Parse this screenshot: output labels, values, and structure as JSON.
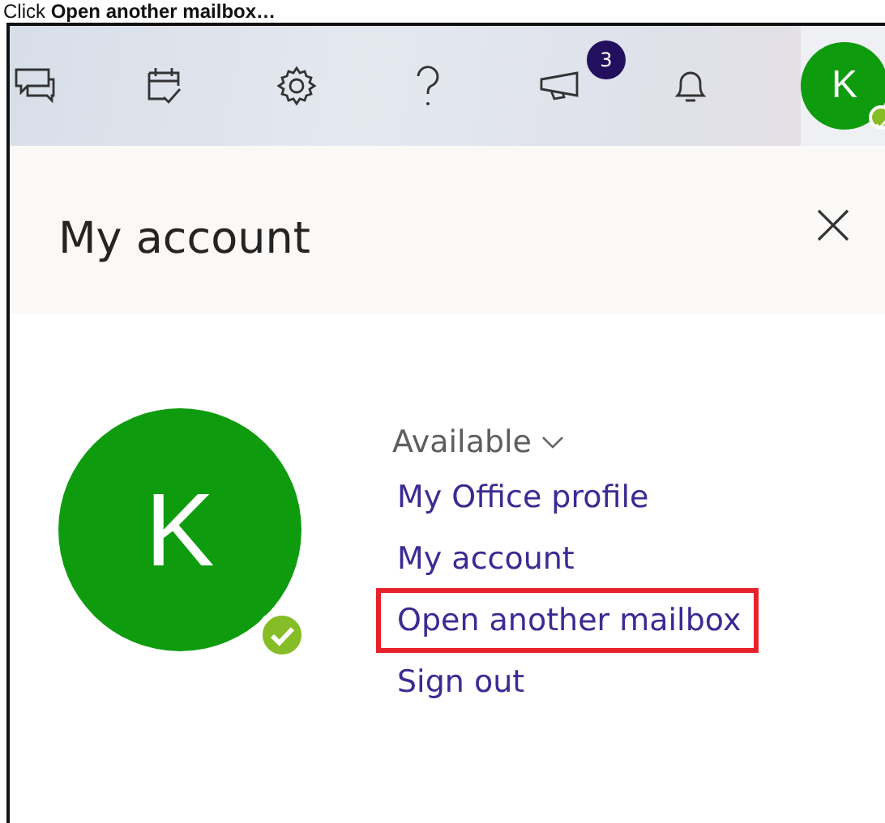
{
  "caption": "Click **Open another mailbox…**",
  "toolbar": {
    "icons": [
      {
        "kind": "chat"
      },
      {
        "kind": "calendar"
      },
      {
        "kind": "settings"
      },
      {
        "kind": "help"
      },
      {
        "kind": "announce",
        "badge": "3"
      },
      {
        "kind": "bell"
      }
    ],
    "avatar": {
      "initial": "K",
      "online": true
    }
  },
  "panel": {
    "title": "My account",
    "avatar": {
      "initial": "K",
      "online": true
    },
    "status": "Available",
    "links": [
      {
        "label": "My Office profile",
        "highlighted": false
      },
      {
        "label": "My account",
        "highlighted": false
      },
      {
        "label": "Open another mailbox",
        "highlighted": true
      },
      {
        "label": "Sign out",
        "highlighted": false
      }
    ]
  }
}
